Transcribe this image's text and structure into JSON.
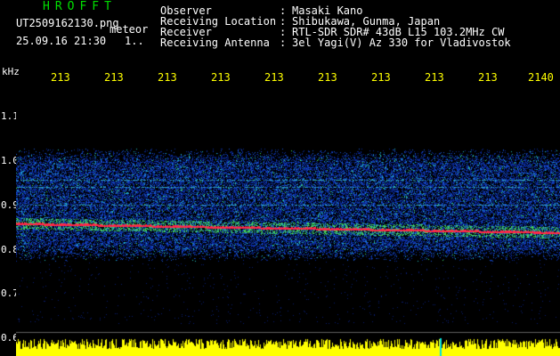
{
  "header": {
    "app_title": "HROFFT",
    "file_name": "UT2509162130.png",
    "type_label": "meteor",
    "timestamp": "25.09.16 21:30",
    "timestamp_extra": "1.."
  },
  "info": [
    {
      "key": "Observer",
      "value": "Masaki Kano"
    },
    {
      "key": "Receiving Location",
      "value": "Shibukawa, Gunma, Japan"
    },
    {
      "key": "Receiver",
      "value": "RTL-SDR SDR# 43dB L15 103.2MHz CW"
    },
    {
      "key": "Receiving Antenna",
      "value": "3el Yagi(V) Az 330 for Vladivostok"
    }
  ],
  "axis": {
    "y_unit": "kHz",
    "y_ticks": [
      "1.1",
      "1.0",
      "0.9",
      "0.8",
      "0.7",
      "0.6"
    ],
    "x_ticks": [
      "213",
      "213",
      "213",
      "213",
      "213",
      "213",
      "213",
      "213",
      "213",
      "2140"
    ]
  },
  "colors": {
    "title": "#00e000",
    "ticks": "#ffff00",
    "noise": "#1a3cb4",
    "trail": "#ff2040"
  }
}
